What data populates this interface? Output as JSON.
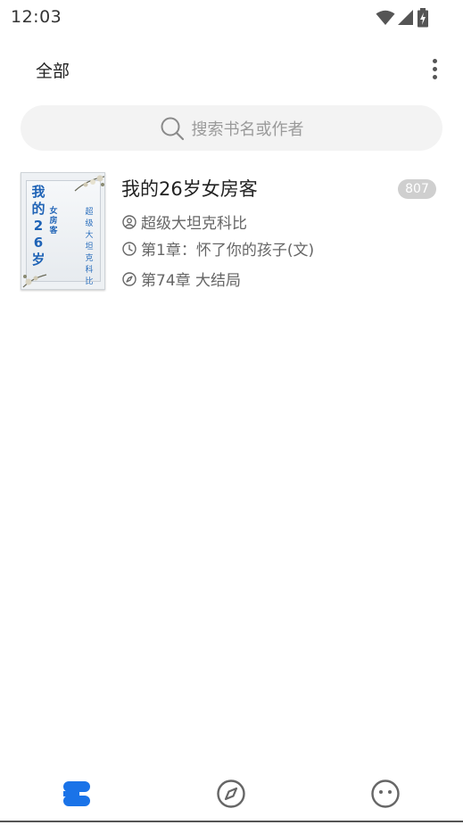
{
  "status_bar": {
    "time": "12:03"
  },
  "toolbar": {
    "title": "全部",
    "more_icon": "more-vertical-icon"
  },
  "search": {
    "placeholder": "搜索书名或作者",
    "icon": "search-icon"
  },
  "books": [
    {
      "title": "我的26岁女房客",
      "badge": "807",
      "author": "超级大坦克科比",
      "last_read": "第1章：怀了你的孩子(文)",
      "latest_chapter": "第74章 大结局",
      "cover": {
        "title": "我的26岁",
        "subtitle": "女房客",
        "author": "超级大坦克科比"
      }
    }
  ],
  "bottom_nav": {
    "items": [
      {
        "name": "bookshelf",
        "icon": "bookshelf-icon",
        "active": true
      },
      {
        "name": "discover",
        "icon": "compass-icon",
        "active": false
      },
      {
        "name": "profile",
        "icon": "face-icon",
        "active": false
      }
    ]
  },
  "colors": {
    "accent": "#1a73e8",
    "icon_gray": "#666666",
    "badge": "#cfcfcf"
  }
}
